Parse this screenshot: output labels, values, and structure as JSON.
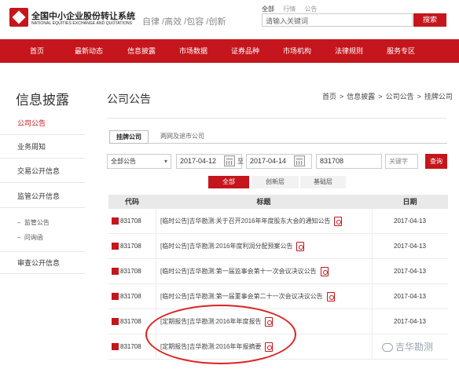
{
  "header": {
    "logo_cn": "全国中小企业股份转让系统",
    "logo_en": "NATIONAL EQUITIES EXCHANGE AND QUOTATIONS",
    "slogan": "自律 /高效 /包容 /创新",
    "search_tabs": [
      "全部",
      "行情",
      "公告"
    ],
    "search_placeholder": "请输入关键词",
    "search_button": "搜索"
  },
  "nav": [
    "首页",
    "最新动态",
    "信息披露",
    "市场数据",
    "证券品种",
    "市场机构",
    "法律规则",
    "服务专区"
  ],
  "sidebar": {
    "title": "信息披露",
    "items": [
      "公司公告",
      "业务周知",
      "交易公开信息",
      "监管公开信息"
    ],
    "sub_items": [
      "监管公告",
      "问询函"
    ],
    "last_item": "审查公开信息"
  },
  "main": {
    "title": "公司公告",
    "breadcrumb": [
      "首页",
      "信息披露",
      "公司公告",
      "挂牌公司"
    ],
    "subtabs": [
      "挂牌公司",
      "两网及退市公司"
    ]
  },
  "filters": {
    "type_select": "全部公告",
    "date_from": "2017-04-12",
    "to_label": "至",
    "date_to": "2017-04-14",
    "code": "831708",
    "keyword_placeholder": "关键字",
    "query_button": "查询"
  },
  "segments": [
    "全部",
    "创新层",
    "基础层"
  ],
  "table": {
    "headers": [
      "代码",
      "标题",
      "日期"
    ],
    "rows": [
      {
        "code": "831708",
        "title": "[临时公告]吉华勘测:关于召开2016年年度股东大会的通知公告",
        "date": "2017-04-13"
      },
      {
        "code": "831708",
        "title": "[临时公告]吉华勘测:2016年度利润分配预案公告",
        "date": "2017-04-13"
      },
      {
        "code": "831708",
        "title": "[临时公告]吉华勘测:第一届监事会第十一次会议决议公告",
        "date": "2017-04-13"
      },
      {
        "code": "831708",
        "title": "[临时公告]吉华勘测:第一届董事会第二十一次会议决议公告",
        "date": "2017-04-13"
      },
      {
        "code": "831708",
        "title": "[定期报告]吉华勘测:2016年年度报告",
        "date": "2017-04-13"
      },
      {
        "code": "831708",
        "title": "[定期报告]吉华勘测:2016年年报摘要",
        "date": ""
      }
    ]
  },
  "watermark": "吉华勘测",
  "colors": {
    "brand_red": "#c4161c",
    "annotation_red": "#dd2222"
  }
}
